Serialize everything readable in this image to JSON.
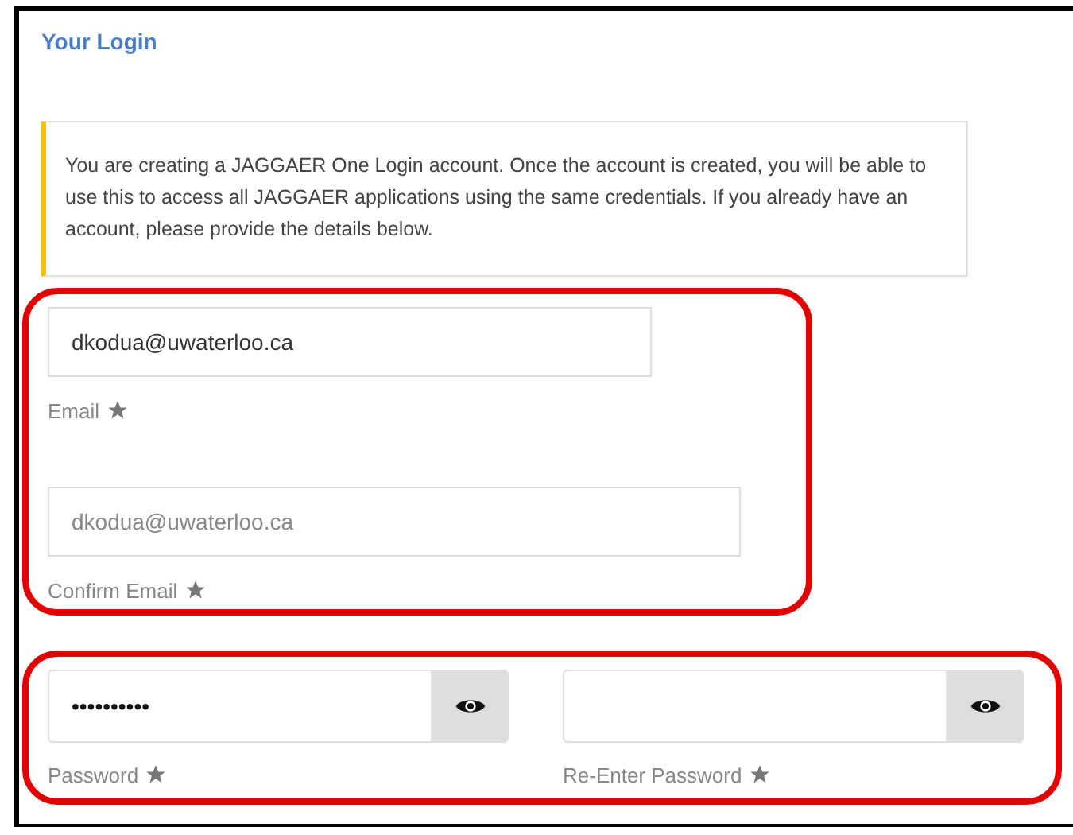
{
  "title": "Your Login",
  "notice": "You are creating a JAGGAER One Login account. Once the account is created, you will be able to use this to access all JAGGAER applications using the same credentials. If you already have an account, please provide the details below.",
  "email_group": {
    "highlighted": true,
    "fields": [
      {
        "label": "Email",
        "required": true,
        "value": "dkodua@uwaterloo.ca"
      },
      {
        "label": "Confirm Email",
        "required": true,
        "placeholder": "dkodua@uwaterloo.ca"
      }
    ]
  },
  "password_group": {
    "highlighted": true,
    "fields": [
      {
        "label": "Password",
        "required": true,
        "value": "••••••••••"
      },
      {
        "label": "Re-Enter Password",
        "required": true
      }
    ]
  }
}
